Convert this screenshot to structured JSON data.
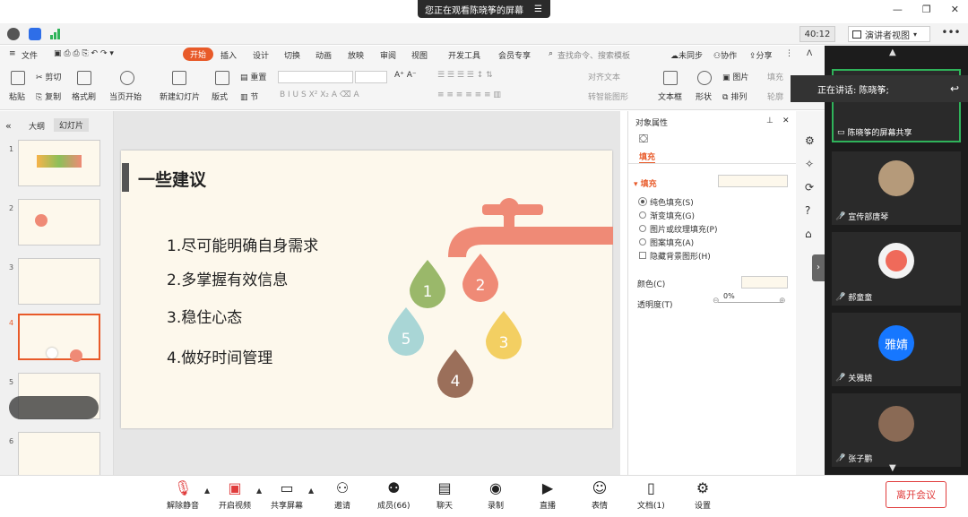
{
  "banner": {
    "text": "您正在观看陈晓筝的屏幕",
    "menu_icon": "list-icon"
  },
  "status": {
    "timer": "40:12",
    "presenter_view": "演讲者视图"
  },
  "menu": {
    "file": "文件",
    "tabs": [
      "开始",
      "插入",
      "设计",
      "切换",
      "动画",
      "放映",
      "审阅",
      "视图",
      "开发工具",
      "会员专享"
    ],
    "search": "查找命令、搜索模板",
    "sync": "未同步",
    "collab": "协作",
    "share": "分享"
  },
  "ribbon": {
    "paste": "粘贴",
    "cut": "剪切",
    "copy": "复制",
    "format_painter": "格式刷",
    "play_from_current": "当页开始",
    "new_slide": "新建幻灯片",
    "layout": "版式",
    "section": "节",
    "reset": "重置",
    "align_text": "对齐文本",
    "smart_graphic": "转智能图形",
    "textbox": "文本框",
    "shape": "形状",
    "picture": "图片",
    "arrange": "排列",
    "fill": "填充",
    "outline": "轮廓"
  },
  "leftpanel": {
    "tab_outline": "大纲",
    "tab_slides": "幻灯片",
    "slide_numbers": [
      "1",
      "2",
      "3",
      "4",
      "5",
      "6"
    ]
  },
  "slide": {
    "title": "一些建议",
    "items": [
      "1.尽可能明确自身需求",
      "2.多掌握有效信息",
      "3.稳住心态",
      "4.做好时间管理"
    ],
    "drops": [
      {
        "label": "1",
        "color": "#9ab86a"
      },
      {
        "label": "2",
        "color": "#ef8a76"
      },
      {
        "label": "3",
        "color": "#f3cf62"
      },
      {
        "label": "4",
        "color": "#9b6f5a"
      },
      {
        "label": "5",
        "color": "#a9d6d6"
      }
    ]
  },
  "props": {
    "header": "对象属性",
    "tab": "填充",
    "section": "填充",
    "options": [
      "纯色填充(S)",
      "渐变填充(G)",
      "图片或纹理填充(P)",
      "图案填充(A)",
      "隐藏背景图形(H)"
    ],
    "color_label": "颜色(C)",
    "transparency_label": "透明度(T)",
    "transparency_value": "0%"
  },
  "video": {
    "speaking": "正在讲话: 陈晓筝;",
    "tiles": [
      {
        "name": "陈晓筝的屏幕共享"
      },
      {
        "name": "宣传部唐琴"
      },
      {
        "name": "郝童童"
      },
      {
        "name": "关雅婧",
        "avatar_text": "雅婧"
      },
      {
        "name": "张子鹏"
      }
    ]
  },
  "bottom": {
    "buttons": [
      "解除静音",
      "开启视频",
      "共享屏幕",
      "邀请",
      "成员(66)",
      "聊天",
      "录制",
      "直播",
      "表情",
      "文档(1)",
      "设置"
    ],
    "leave": "离开会议"
  },
  "colors": {
    "accent": "#e85a29",
    "leave": "#e03c3c",
    "video_bg": "#1c1c1c"
  }
}
